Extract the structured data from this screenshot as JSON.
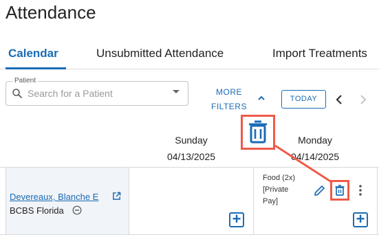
{
  "page": {
    "title": "Attendance"
  },
  "tabs": [
    {
      "label": "Calendar",
      "active": true
    },
    {
      "label": "Unsubmitted Attendance",
      "active": false
    },
    {
      "label": "Import Treatments",
      "active": false
    }
  ],
  "patient_filter": {
    "legend": "Patient",
    "placeholder": "Search for a Patient"
  },
  "toolbar": {
    "more_filters_line1": "MORE",
    "more_filters_line2": "FILTERS",
    "today_label": "TODAY"
  },
  "days": [
    {
      "name": "Sunday",
      "date": "04/13/2025"
    },
    {
      "name": "Monday",
      "date": "04/14/2025"
    }
  ],
  "row": {
    "patient_name": "Devereaux, Blanche E",
    "insurance": "BCBS Florida",
    "appointment": {
      "line1": "Food (2x)",
      "line2": "[Private",
      "line3": "Pay]"
    }
  },
  "icons": [
    "search-icon",
    "caret-down-icon",
    "chevron-up-icon",
    "chevron-left-icon",
    "chevron-right-icon",
    "open-in-new-icon",
    "minus-circle-icon",
    "edit-icon",
    "trash-icon",
    "kebab-icon",
    "plus-icon"
  ],
  "colors": {
    "accent": "#1a6bb5",
    "highlight": "#ef5a48",
    "patient_cell_bg": "#f1f4f8"
  }
}
